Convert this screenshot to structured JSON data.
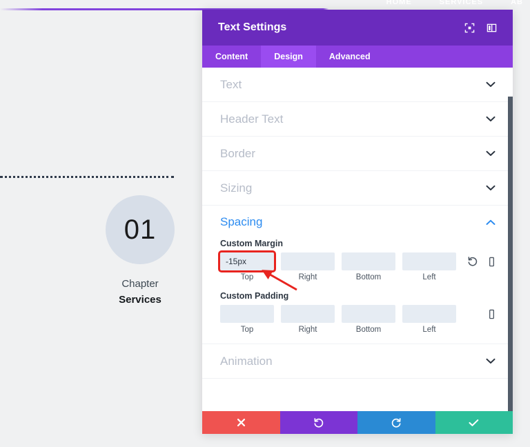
{
  "site": {
    "nav_items": [
      "HOME",
      "SERVICES",
      "AB"
    ],
    "chapter": {
      "number": "01",
      "label": "Chapter",
      "title": "Services"
    }
  },
  "modal": {
    "title": "Text Settings",
    "header_icons": [
      {
        "name": "expand-icon",
        "glyph": "expand"
      },
      {
        "name": "layout-columns-icon",
        "glyph": "layout"
      }
    ],
    "tabs": [
      {
        "label": "Content",
        "active": false
      },
      {
        "label": "Design",
        "active": true
      },
      {
        "label": "Advanced",
        "active": false
      }
    ],
    "sections": [
      {
        "label": "Text",
        "open": false
      },
      {
        "label": "Header Text",
        "open": false
      },
      {
        "label": "Border",
        "open": false
      },
      {
        "label": "Sizing",
        "open": false
      },
      {
        "label": "Spacing",
        "open": true
      },
      {
        "label": "Animation",
        "open": false
      }
    ],
    "spacing": {
      "heading": "Spacing",
      "custom_margin": {
        "title": "Custom Margin",
        "fields": [
          {
            "sub": "Top",
            "value": "-15px",
            "placeholder": "",
            "highlight": true
          },
          {
            "sub": "Right",
            "value": "",
            "placeholder": "",
            "highlight": false
          },
          {
            "sub": "Bottom",
            "value": "",
            "placeholder": "",
            "highlight": false
          },
          {
            "sub": "Left",
            "value": "",
            "placeholder": "",
            "highlight": false
          }
        ],
        "tools": [
          "reset-icon",
          "device-toggle-icon"
        ]
      },
      "custom_padding": {
        "title": "Custom Padding",
        "fields": [
          {
            "sub": "Top",
            "value": "",
            "placeholder": "",
            "highlight": false
          },
          {
            "sub": "Right",
            "value": "",
            "placeholder": "",
            "highlight": false
          },
          {
            "sub": "Bottom",
            "value": "",
            "placeholder": "",
            "highlight": false
          },
          {
            "sub": "Left",
            "value": "",
            "placeholder": "",
            "highlight": false
          }
        ],
        "tools": [
          "device-toggle-icon"
        ]
      }
    },
    "footer_buttons": [
      {
        "name": "cancel-button",
        "glyph": "✖",
        "color": "#ef5350"
      },
      {
        "name": "undo-button",
        "glyph": "↺",
        "color": "#7c34d4"
      },
      {
        "name": "redo-button",
        "glyph": "↻",
        "color": "#2a8ad4"
      },
      {
        "name": "save-button",
        "glyph": "✔",
        "color": "#2dbf9a"
      }
    ]
  },
  "annotation": {
    "arrow_color": "#e8241f",
    "highlight_color": "#e8241f"
  }
}
